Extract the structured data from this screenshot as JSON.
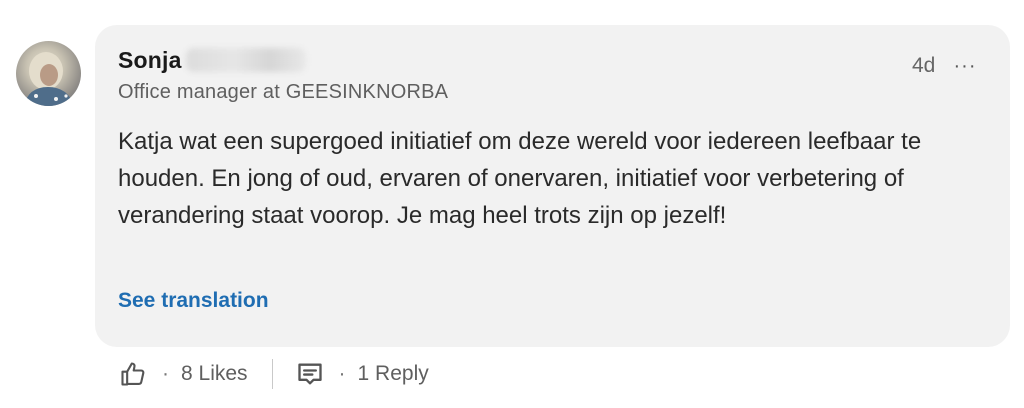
{
  "comment": {
    "author_name": "Sonja",
    "author_headline": "Office manager at GEESINKNORBA",
    "timestamp": "4d",
    "more_label": "···",
    "body": "Katja wat een supergoed initiatief om deze wereld voor iedereen leefbaar te houden. En jong of oud, ervaren of onervaren, initiatief voor verbetering of verandering staat voorop. Je mag heel trots zijn op jezelf!",
    "see_translation": "See translation"
  },
  "actions": {
    "separator": "·",
    "likes_label": "8 Likes",
    "reply_label": "1 Reply"
  },
  "icons": {
    "avatar": "avatar",
    "like": "thumbs-up-icon",
    "reply": "reply-icon",
    "more": "ellipsis-icon"
  }
}
